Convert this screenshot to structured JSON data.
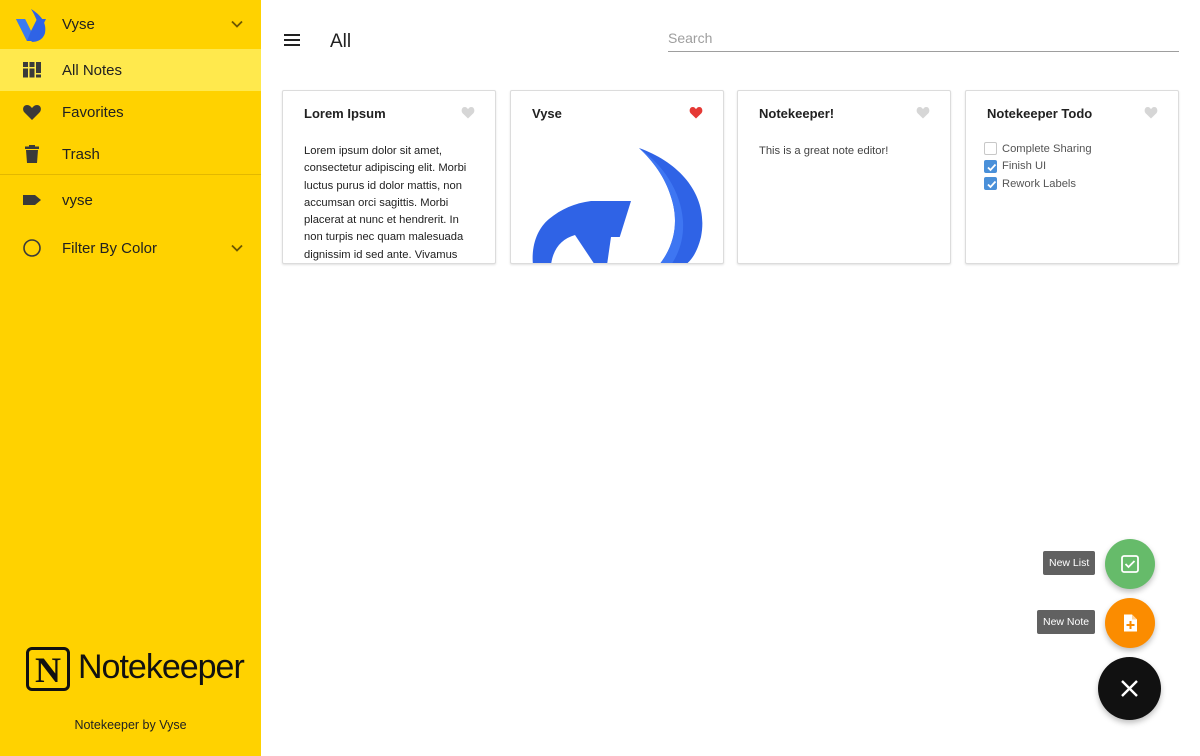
{
  "account": {
    "name": "Vyse"
  },
  "nav": {
    "all_notes": "All Notes",
    "favorites": "Favorites",
    "trash": "Trash",
    "label_vyse": "vyse",
    "filter_by_color": "Filter By Color"
  },
  "brand": {
    "letter": "N",
    "name": "Notekeeper"
  },
  "footer": "Notekeeper by Vyse",
  "header": {
    "title": "All",
    "search_placeholder": "Search"
  },
  "notes": [
    {
      "title": "Lorem Ipsum",
      "favorite": false,
      "body": "Lorem ipsum dolor sit amet, consectetur adipiscing elit. Morbi luctus purus id dolor mattis, non accumsan orci sagittis. Morbi placerat at nunc et hendrerit. In non turpis nec quam malesuada dignissim id sed ante. Vivamus"
    },
    {
      "title": "Vyse",
      "favorite": true,
      "image": "vyse-logo"
    },
    {
      "title": "Notekeeper!",
      "favorite": false,
      "body": "This is a great note editor!"
    },
    {
      "title": "Notekeeper Todo",
      "favorite": false,
      "todos": [
        {
          "text": "Complete Sharing",
          "checked": false
        },
        {
          "text": "Finish UI",
          "checked": true
        },
        {
          "text": "Rework Labels",
          "checked": true
        }
      ]
    }
  ],
  "fabs": {
    "new_list": "New List",
    "new_note": "New Note"
  },
  "colors": {
    "sidebar": "#FFD200",
    "sidebar_active": "#FFE94D",
    "heart_favorite": "#E53935",
    "heart_default": "#D6D6D6",
    "checkbox": "#4A90D9",
    "fab_list": "#66BB6A",
    "fab_note": "#FB8C00",
    "fab_close": "#111111",
    "logo_blue": "#2F63E6"
  }
}
